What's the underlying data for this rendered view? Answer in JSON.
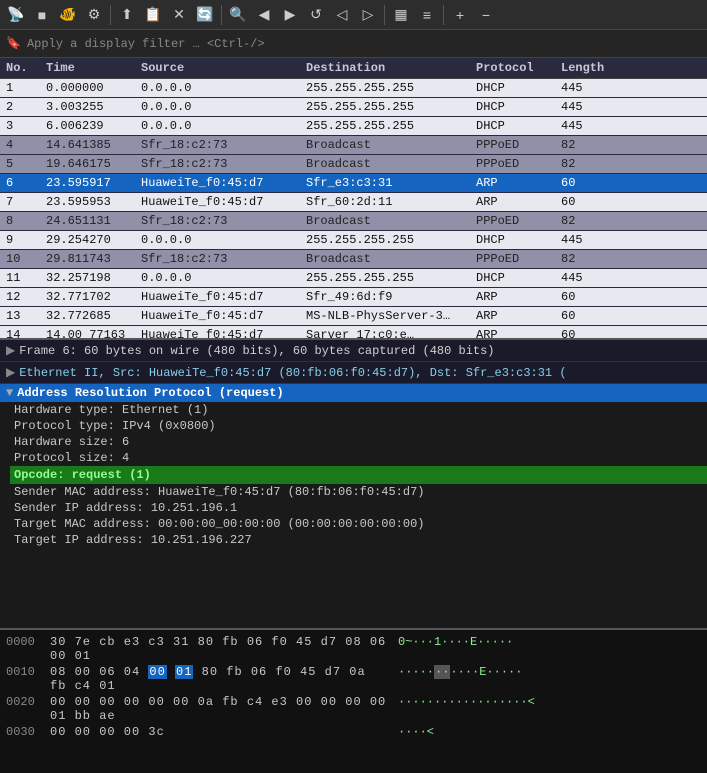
{
  "toolbar": {
    "buttons": [
      {
        "name": "antenna-icon",
        "symbol": "📡"
      },
      {
        "name": "stop-icon",
        "symbol": "■"
      },
      {
        "name": "fish-icon",
        "symbol": "🐟"
      },
      {
        "name": "settings-icon",
        "symbol": "⚙"
      },
      {
        "name": "up-arrow-icon",
        "symbol": "⬆"
      },
      {
        "name": "copy-icon",
        "symbol": "📋"
      },
      {
        "name": "x-icon",
        "symbol": "✕"
      },
      {
        "name": "reload-icon",
        "symbol": "🔄"
      },
      {
        "name": "search-icon",
        "symbol": "🔍"
      },
      {
        "name": "left-icon",
        "symbol": "◀"
      },
      {
        "name": "right-icon",
        "symbol": "▶"
      },
      {
        "name": "loop-icon",
        "symbol": "↺"
      },
      {
        "name": "left2-icon",
        "symbol": "◁"
      },
      {
        "name": "right2-icon",
        "symbol": "▷"
      },
      {
        "name": "capture-icon",
        "symbol": "▦"
      },
      {
        "name": "list-icon",
        "symbol": "≡"
      },
      {
        "name": "plus-icon",
        "symbol": "+"
      },
      {
        "name": "minus-icon",
        "symbol": "−"
      }
    ]
  },
  "filter": {
    "placeholder": "Apply a display filter … <Ctrl-/>"
  },
  "columns": [
    "No.",
    "Time",
    "Source",
    "Destination",
    "Protocol",
    "Length"
  ],
  "packets": [
    {
      "no": "1",
      "time": "0.000000",
      "src": "0.0.0.0",
      "dst": "255.255.255.255",
      "proto": "DHCP",
      "len": "445",
      "style": "white"
    },
    {
      "no": "2",
      "time": "3.003255",
      "src": "0.0.0.0",
      "dst": "255.255.255.255",
      "proto": "DHCP",
      "len": "445",
      "style": "white"
    },
    {
      "no": "3",
      "time": "6.006239",
      "src": "0.0.0.0",
      "dst": "255.255.255.255",
      "proto": "DHCP",
      "len": "445",
      "style": "white"
    },
    {
      "no": "4",
      "time": "14.641385",
      "src": "Sfr_18:c2:73",
      "dst": "Broadcast",
      "proto": "PPPoED",
      "len": "82",
      "style": "darker"
    },
    {
      "no": "5",
      "time": "19.646175",
      "src": "Sfr_18:c2:73",
      "dst": "Broadcast",
      "proto": "PPPoED",
      "len": "82",
      "style": "darker"
    },
    {
      "no": "6",
      "time": "23.595917",
      "src": "HuaweiTe_f0:45:d7",
      "dst": "Sfr_e3:c3:31",
      "proto": "ARP",
      "len": "60",
      "style": "selected"
    },
    {
      "no": "7",
      "time": "23.595953",
      "src": "HuaweiTe_f0:45:d7",
      "dst": "Sfr_60:2d:11",
      "proto": "ARP",
      "len": "60",
      "style": "white"
    },
    {
      "no": "8",
      "time": "24.651131",
      "src": "Sfr_18:c2:73",
      "dst": "Broadcast",
      "proto": "PPPoED",
      "len": "82",
      "style": "darker"
    },
    {
      "no": "9",
      "time": "29.254270",
      "src": "0.0.0.0",
      "dst": "255.255.255.255",
      "proto": "DHCP",
      "len": "445",
      "style": "white"
    },
    {
      "no": "10",
      "time": "29.811743",
      "src": "Sfr_18:c2:73",
      "dst": "Broadcast",
      "proto": "PPPoED",
      "len": "82",
      "style": "darker"
    },
    {
      "no": "11",
      "time": "32.257198",
      "src": "0.0.0.0",
      "dst": "255.255.255.255",
      "proto": "DHCP",
      "len": "445",
      "style": "white"
    },
    {
      "no": "12",
      "time": "32.771702",
      "src": "HuaweiTe_f0:45:d7",
      "dst": "Sfr_49:6d:f9",
      "proto": "ARP",
      "len": "60",
      "style": "white"
    },
    {
      "no": "13",
      "time": "32.772685",
      "src": "HuaweiTe_f0:45:d7",
      "dst": "MS-NLB-PhysServer-3…",
      "proto": "ARP",
      "len": "60",
      "style": "white"
    },
    {
      "no": "14",
      "time": "14.00 77163",
      "src": "HuaweiTe_f0:45:d7",
      "dst": "Sarver_17:c0:e…",
      "proto": "ARP",
      "len": "60",
      "style": "white"
    }
  ],
  "detail": {
    "frame_line": "Frame 6: 60 bytes on wire (480 bits), 60 bytes captured (480 bits)",
    "ethernet_line": "Ethernet II, Src: HuaweiTe_f0:45:d7 (80:fb:06:f0:45:d7), Dst: Sfr_e3:c3:31 (",
    "arp_header": "Address Resolution Protocol (request)",
    "fields": [
      {
        "label": "Hardware type: Ethernet (1)"
      },
      {
        "label": "Protocol type: IPv4 (0x0800)"
      },
      {
        "label": "Hardware size: 6"
      },
      {
        "label": "Protocol size: 4"
      },
      {
        "label": "Opcode: request (1)",
        "highlighted": true
      },
      {
        "label": "Sender MAC address: HuaweiTe_f0:45:d7 (80:fb:06:f0:45:d7)"
      },
      {
        "label": "Sender IP address: 10.251.196.1"
      },
      {
        "label": "Target MAC address: 00:00:00_00:00:00 (00:00:00:00:00:00)"
      },
      {
        "label": "Target IP address: 10.251.196.227"
      }
    ]
  },
  "hex": {
    "rows": [
      {
        "offset": "0000",
        "bytes": "30 7e cb e3 c3 31 80 fb  06 f0 45 d7 08 06 00 01",
        "ascii": "0~···1····E·····"
      },
      {
        "offset": "0010",
        "bytes": "08 00 06 04 00 01 80 fb  06 f0 45 d7 0a fb c4 01",
        "ascii": "··········E·····",
        "hl_start": 4,
        "hl_end": 6
      },
      {
        "offset": "0020",
        "bytes": "00 00 00 00 00 00 0a fb  c4 e3 00 00 00 00 01 bb ae",
        "ascii": "··················<"
      },
      {
        "offset": "0030",
        "bytes": "00 00 00 00 3c",
        "ascii": "····<"
      }
    ]
  }
}
